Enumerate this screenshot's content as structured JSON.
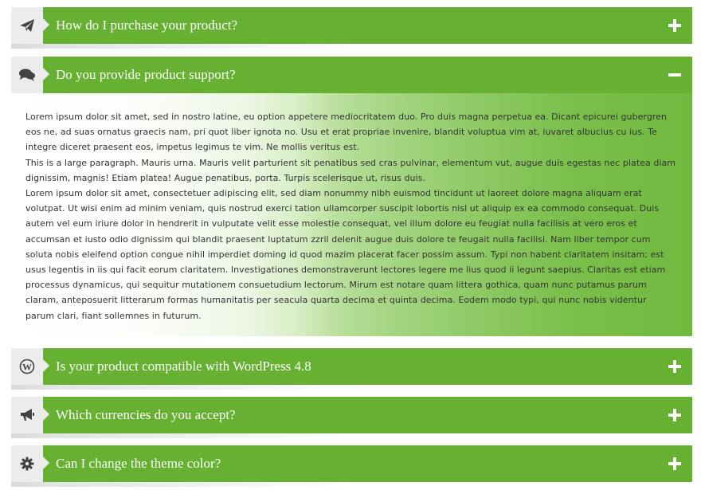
{
  "faq": {
    "items": [
      {
        "icon": "paper-plane-icon",
        "question": "How do I purchase your product?",
        "expanded": false
      },
      {
        "icon": "chat-bubbles-icon",
        "question": "Do you provide product support?",
        "expanded": true
      },
      {
        "icon": "wordpress-icon",
        "question": "Is your product compatible with WordPress 4.8",
        "expanded": false
      },
      {
        "icon": "megaphone-icon",
        "question": "Which currencies do you accept?",
        "expanded": false
      },
      {
        "icon": "gear-icon",
        "question": "Can I change the theme color?",
        "expanded": false
      }
    ],
    "answer": {
      "paragraphs": [
        "Lorem ipsum dolor sit amet, sed in nostro latine, eu option appetere mediocritatem duo. Pro duis magna perpetua ea. Dicant epicurei gubergren eos ne, ad suas ornatus graecis nam, pri quot liber ignota no. Usu et erat propriae invenire, blandit voluptua vim at, iuvaret albucius cu ius. Te integre diceret praesent eos, impetus legimus te vim. Ne mollis veritus est.",
        "This is a large paragraph. Mauris urna. Mauris velit parturient sit penatibus sed cras pulvinar, elementum vut, augue duis egestas nec platea diam dignissim, magnis! Etiam platea! Augue penatibus, porta. Turpis scelerisque ut, risus duis.",
        "Lorem ipsum dolor sit amet, consectetuer adipiscing elit, sed diam nonummy nibh euismod tincidunt ut laoreet dolore magna aliquam erat volutpat. Ut wisi enim ad minim veniam, quis nostrud exerci tation ullamcorper suscipit lobortis nisl ut aliquip ex ea commodo consequat. Duis autem vel eum iriure dolor in hendrerit in vulputate velit esse molestie consequat, vel illum dolore eu feugiat nulla facilisis at vero eros et accumsan et iusto odio dignissim qui blandit praesent luptatum zzril delenit augue duis dolore te feugait nulla facilisi. Nam liber tempor cum soluta nobis eleifend option congue nihil imperdiet doming id quod mazim placerat facer possim assum. Typi non habent claritatem insitam; est usus legentis in iis qui facit eorum claritatem. Investigationes demonstraverunt lectores legere me lius quod ii legunt saepius. Claritas est etiam processus dynamicus, qui sequitur mutationem consuetudium lectorum. Mirum est notare quam littera gothica, quam nunc putamus parum claram, anteposuerit litterarum formas humanitatis per seacula quarta decima et quinta decima. Eodem modo typi, qui nunc nobis videntur parum clari, fiant sollemnes in futurum."
      ]
    }
  },
  "colors": {
    "accent": "#66b032",
    "icon_bg": "#ececec",
    "icon_color": "#444444",
    "text_white": "#ffffff"
  }
}
